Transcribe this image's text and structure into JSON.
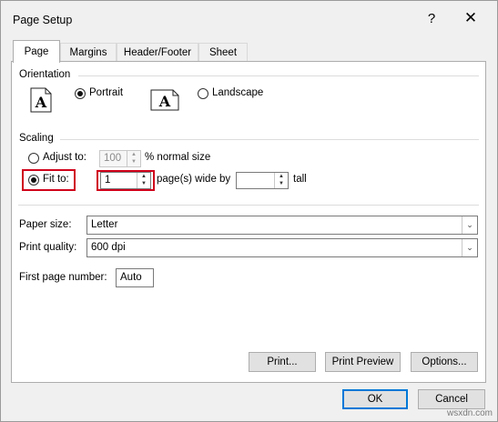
{
  "dialog": {
    "title": "Page Setup",
    "help": "?",
    "close": "✕"
  },
  "tabs": [
    {
      "label": "Page",
      "active": true
    },
    {
      "label": "Margins",
      "active": false
    },
    {
      "label": "Header/Footer",
      "active": false
    },
    {
      "label": "Sheet",
      "active": false
    }
  ],
  "orientation": {
    "heading": "Orientation",
    "portrait": {
      "label": "Portrait",
      "selected": true
    },
    "landscape": {
      "label": "Landscape",
      "selected": false
    },
    "icon_letter": "A"
  },
  "scaling": {
    "heading": "Scaling",
    "adjust_to": {
      "label": "Adjust to:",
      "value": "100",
      "suffix": "% normal size",
      "selected": false
    },
    "fit_to": {
      "label": "Fit to:",
      "selected": true,
      "wide_value": "1",
      "wide_suffix": "page(s) wide by",
      "tall_value": "",
      "tall_suffix": "tall"
    }
  },
  "paper_size": {
    "label": "Paper size:",
    "value": "Letter"
  },
  "print_quality": {
    "label": "Print quality:",
    "value": "600 dpi"
  },
  "first_page_number": {
    "label": "First page number:",
    "value": "Auto"
  },
  "buttons": {
    "print": "Print...",
    "print_preview": "Print Preview",
    "options": "Options...",
    "ok": "OK",
    "cancel": "Cancel"
  },
  "watermark": "wsxdn.com",
  "colors": {
    "highlight": "#d0021b",
    "default_button_border": "#0078d7"
  }
}
